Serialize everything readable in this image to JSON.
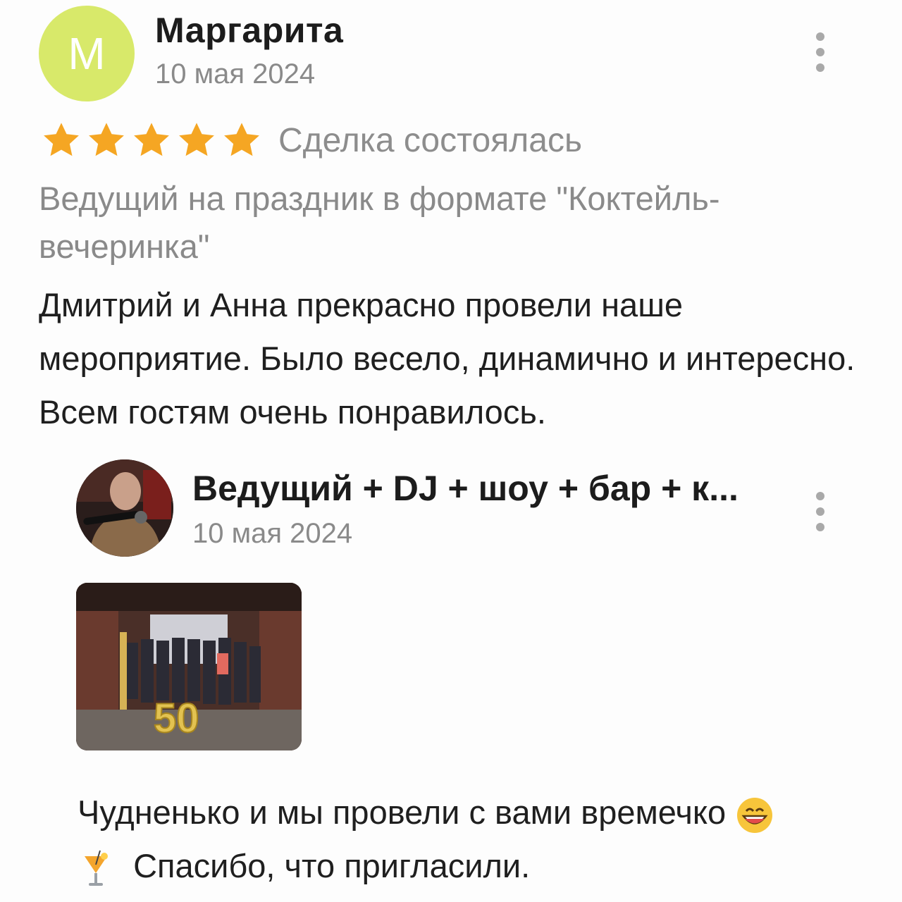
{
  "review": {
    "avatar_letter": "М",
    "author": "Маргарита",
    "date": "10 мая 2024",
    "rating": 5,
    "rating_max": 5,
    "deal_status": "Сделка состоялась",
    "service": "Ведущий на праздник в формате \"Коктейль-вечеринка\"",
    "text": "Дмитрий и Анна прекрасно провели наше мероприятие. Было весело, динамично и интересно. Всем гостям очень понравилось."
  },
  "reply": {
    "author": "Ведущий + DJ + шоу + бар + к...",
    "date": "10 мая 2024",
    "photo_badge": "50",
    "text_line1": "Чудненько и мы провели с вами времечко",
    "text_line2": "Спасибо, что пригласили."
  },
  "colors": {
    "avatar_bg": "#d8e96a",
    "star": "#f5a623",
    "muted_text": "#8a8a8a"
  },
  "icons": [
    "more-vertical-icon",
    "star-icon",
    "grinning-face-emoji",
    "cocktail-emoji"
  ]
}
